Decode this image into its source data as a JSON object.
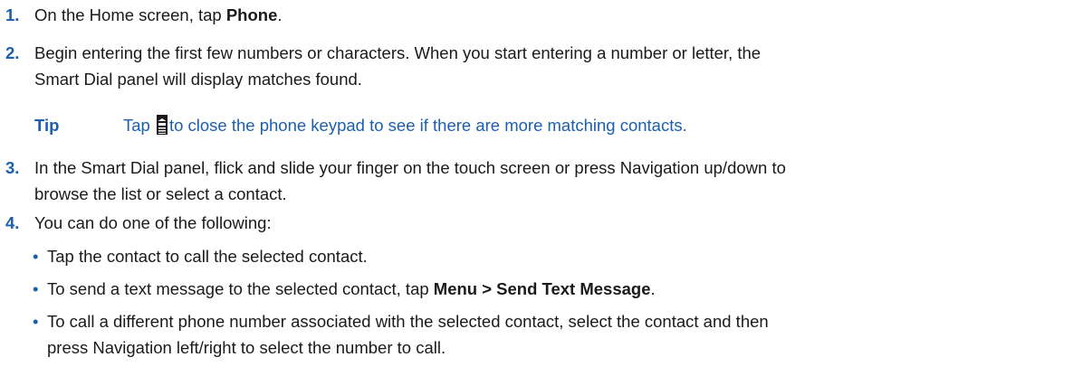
{
  "steps": [
    {
      "num": "1.",
      "pre": "On the Home screen, tap ",
      "bold": "Phone",
      "post": "."
    },
    {
      "num": "2.",
      "line1": "Begin entering the first few numbers or characters. When you start entering a number or letter, the",
      "line2": "Smart Dial panel will display matches found."
    },
    {
      "num": "3.",
      "line1": "In the Smart Dial panel, flick and slide your finger on the touch screen or press Navigation up/down to",
      "line2": "browse the list or select a contact."
    },
    {
      "num": "4.",
      "text": "You can do one of the following:"
    }
  ],
  "tip": {
    "label": "Tip",
    "pre": "Tap",
    "icon": "keypad-toggle-icon",
    "post": "to close the phone keypad to see if there are more matching contacts."
  },
  "bullets": [
    {
      "text": "Tap the contact to call the selected contact."
    },
    {
      "pre": "To send a text message to the selected contact, tap ",
      "bold": "Menu > Send Text Message",
      "post": "."
    },
    {
      "line1": "To call a different phone number associated with the selected contact, select the contact and then",
      "line2": "press Navigation left/right to select the number to call."
    }
  ],
  "colors": {
    "accent": "#1b5fae",
    "text": "#1a1a1a"
  }
}
